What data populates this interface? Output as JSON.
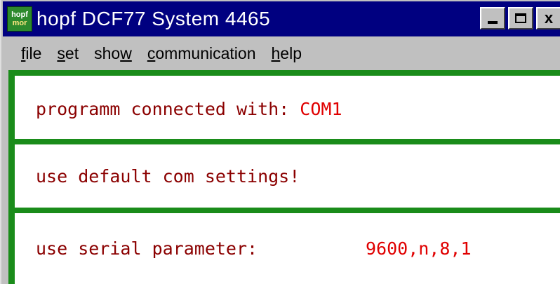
{
  "window": {
    "title": "hopf DCF77 System 4465",
    "app_icon_top": "hopf",
    "app_icon_bottom": "mor",
    "buttons": {
      "minimize": "_",
      "maximize": "□",
      "close": "x"
    }
  },
  "menu": {
    "items": [
      {
        "label": "file",
        "mnemonic": "f"
      },
      {
        "label": "set",
        "mnemonic": "s"
      },
      {
        "label": "show",
        "mnemonic": "w"
      },
      {
        "label": "communication",
        "mnemonic": "c"
      },
      {
        "label": "help",
        "mnemonic": "h"
      }
    ]
  },
  "status": {
    "connected_label": "programm connected with:",
    "connected_port": "COM1",
    "default_settings": "use default com settings!",
    "serial_label": "use serial parameter:",
    "serial_value": "9600,n,8,1"
  },
  "colors": {
    "titlebar": "#000080",
    "panel_border": "#1a8c1a",
    "text": "#8b0000",
    "value": "#e00000"
  }
}
